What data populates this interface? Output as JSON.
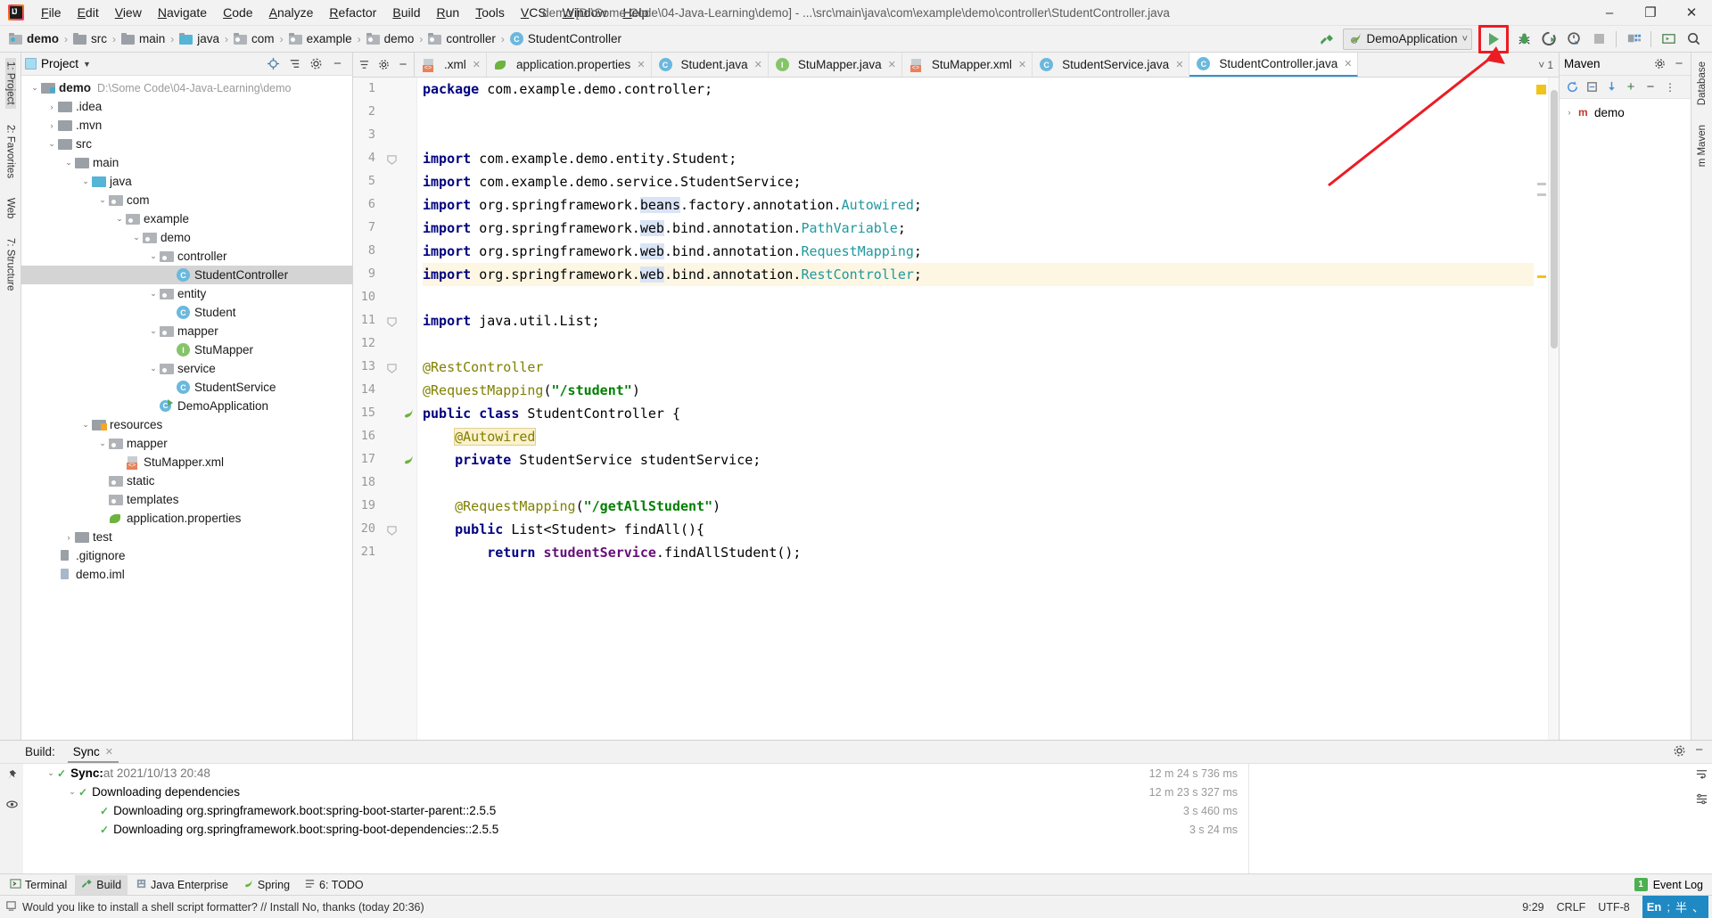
{
  "titlebar": {
    "window_title": "demo [D:\\Some Code\\04-Java-Learning\\demo] - ...\\src\\main\\java\\com\\example\\demo\\controller\\StudentController.java",
    "logo": "intellij-idea-logo",
    "menu": [
      "File",
      "Edit",
      "View",
      "Navigate",
      "Code",
      "Analyze",
      "Refactor",
      "Build",
      "Run",
      "Tools",
      "VCS",
      "Window",
      "Help"
    ],
    "window_controls": {
      "minimize": "–",
      "maximize": "❐",
      "close": "✕"
    }
  },
  "navbar": {
    "breadcrumbs": [
      {
        "label": "demo",
        "type": "module"
      },
      {
        "label": "src",
        "type": "folder"
      },
      {
        "label": "main",
        "type": "folder"
      },
      {
        "label": "java",
        "type": "source-root"
      },
      {
        "label": "com",
        "type": "package"
      },
      {
        "label": "example",
        "type": "package"
      },
      {
        "label": "demo",
        "type": "package"
      },
      {
        "label": "controller",
        "type": "package"
      },
      {
        "label": "StudentController",
        "type": "class"
      }
    ],
    "separator": "›",
    "toolbar": {
      "build_icon": "hammer-icon",
      "run_config_name": "DemoApplication",
      "run_config_dropdown": "˅",
      "run_icon": "run-play-icon",
      "debug_icon": "debug-bug-icon",
      "run_coverage_icon": "run-with-coverage-icon",
      "profiler_icon": "profiler-icon",
      "stop_icon": "stop-icon",
      "project_structure_icon": "project-structure-icon",
      "terminal_icon": "terminal-icon",
      "search_icon": "search-everywhere-icon"
    }
  },
  "annotation": {
    "type": "red-arrow-and-box",
    "color": "#ec1c24",
    "points_to": "run-button"
  },
  "left_rail": [
    {
      "label": "1: Project",
      "selected": true
    },
    {
      "label": "2: Favorites",
      "selected": false
    },
    {
      "label": "Web",
      "selected": false
    },
    {
      "label": "7: Structure",
      "selected": false
    }
  ],
  "right_rail": [
    {
      "label": "Database",
      "selected": false
    },
    {
      "label": "m Maven",
      "selected": false
    }
  ],
  "project_panel": {
    "title": "Project",
    "dropdown": "▼",
    "header_icons": [
      "locate-icon",
      "collapse-all-icon",
      "settings-gear-icon",
      "hide-icon"
    ],
    "tree": [
      {
        "indent": 0,
        "twist": "⌄",
        "icon": "module",
        "label": "demo",
        "bold": true,
        "path": "D:\\Some Code\\04-Java-Learning\\demo",
        "selected": false
      },
      {
        "indent": 1,
        "twist": "›",
        "icon": "folder",
        "label": ".idea",
        "selected": false
      },
      {
        "indent": 1,
        "twist": "›",
        "icon": "folder",
        "label": ".mvn",
        "selected": false
      },
      {
        "indent": 1,
        "twist": "⌄",
        "icon": "folder",
        "label": "src",
        "selected": false
      },
      {
        "indent": 2,
        "twist": "⌄",
        "icon": "folder",
        "label": "main",
        "selected": false
      },
      {
        "indent": 3,
        "twist": "⌄",
        "icon": "source-root",
        "label": "java",
        "selected": false
      },
      {
        "indent": 4,
        "twist": "⌄",
        "icon": "package",
        "label": "com",
        "selected": false
      },
      {
        "indent": 5,
        "twist": "⌄",
        "icon": "package",
        "label": "example",
        "selected": false
      },
      {
        "indent": 6,
        "twist": "⌄",
        "icon": "package",
        "label": "demo",
        "selected": false
      },
      {
        "indent": 7,
        "twist": "⌄",
        "icon": "package",
        "label": "controller",
        "selected": false
      },
      {
        "indent": 8,
        "twist": "",
        "icon": "class",
        "label": "StudentController",
        "selected": true
      },
      {
        "indent": 7,
        "twist": "⌄",
        "icon": "package",
        "label": "entity",
        "selected": false
      },
      {
        "indent": 8,
        "twist": "",
        "icon": "class",
        "label": "Student",
        "selected": false
      },
      {
        "indent": 7,
        "twist": "⌄",
        "icon": "package",
        "label": "mapper",
        "selected": false
      },
      {
        "indent": 8,
        "twist": "",
        "icon": "interface",
        "label": "StuMapper",
        "selected": false
      },
      {
        "indent": 7,
        "twist": "⌄",
        "icon": "package",
        "label": "service",
        "selected": false
      },
      {
        "indent": 8,
        "twist": "",
        "icon": "class",
        "label": "StudentService",
        "selected": false
      },
      {
        "indent": 7,
        "twist": "",
        "icon": "spring-app",
        "label": "DemoApplication",
        "selected": false
      },
      {
        "indent": 3,
        "twist": "⌄",
        "icon": "resources",
        "label": "resources",
        "selected": false
      },
      {
        "indent": 4,
        "twist": "⌄",
        "icon": "package",
        "label": "mapper",
        "selected": false
      },
      {
        "indent": 5,
        "twist": "",
        "icon": "xml-file",
        "label": "StuMapper.xml",
        "selected": false
      },
      {
        "indent": 4,
        "twist": "",
        "icon": "package",
        "label": "static",
        "selected": false
      },
      {
        "indent": 4,
        "twist": "",
        "icon": "package",
        "label": "templates",
        "selected": false
      },
      {
        "indent": 4,
        "twist": "",
        "icon": "spring-properties",
        "label": "application.properties",
        "selected": false
      },
      {
        "indent": 2,
        "twist": "›",
        "icon": "folder",
        "label": "test",
        "selected": false
      },
      {
        "indent": 1,
        "twist": "",
        "icon": "gitignore",
        "label": ".gitignore",
        "selected": false
      },
      {
        "indent": 1,
        "twist": "",
        "icon": "iml",
        "label": "demo.iml",
        "selected": false
      }
    ]
  },
  "editor": {
    "tab_strip_icons": [
      "sort-icon",
      "gear-icon",
      "hide-icon"
    ],
    "tabs": [
      {
        "label": ".xml",
        "icon": "xml-file",
        "active": false
      },
      {
        "label": "application.properties",
        "icon": "spring-properties",
        "active": false
      },
      {
        "label": "Student.java",
        "icon": "class",
        "active": false
      },
      {
        "label": "StuMapper.java",
        "icon": "interface",
        "active": false
      },
      {
        "label": "StuMapper.xml",
        "icon": "xml-file",
        "active": false
      },
      {
        "label": "StudentService.java",
        "icon": "class",
        "active": false
      },
      {
        "label": "StudentController.java",
        "icon": "class",
        "active": true
      }
    ],
    "tab_end": {
      "chevron": "˅",
      "count": "1"
    },
    "file_name": "StudentController.java",
    "lines": [
      {
        "n": 1,
        "tokens": [
          {
            "t": "package ",
            "c": "kw"
          },
          {
            "t": "com.example.demo.controller;",
            "c": "plain"
          }
        ]
      },
      {
        "n": 2,
        "tokens": []
      },
      {
        "n": 3,
        "tokens": []
      },
      {
        "n": 4,
        "tokens": [
          {
            "t": "import ",
            "c": "kw"
          },
          {
            "t": "com.example.demo.entity.",
            "c": "plain"
          },
          {
            "t": "Student",
            "c": "plain"
          },
          {
            "t": ";",
            "c": "plain"
          }
        ],
        "fold": true
      },
      {
        "n": 5,
        "tokens": [
          {
            "t": "import ",
            "c": "kw"
          },
          {
            "t": "com.example.demo.service.",
            "c": "plain"
          },
          {
            "t": "StudentService",
            "c": "plain"
          },
          {
            "t": ";",
            "c": "plain"
          }
        ]
      },
      {
        "n": 6,
        "tokens": [
          {
            "t": "import ",
            "c": "kw"
          },
          {
            "t": "org.springframework.",
            "c": "plain"
          },
          {
            "t": "beans",
            "c": "hl-blue"
          },
          {
            "t": ".factory.annotation.",
            "c": "plain"
          },
          {
            "t": "Autowired",
            "c": "cls-name"
          },
          {
            "t": ";",
            "c": "plain"
          }
        ]
      },
      {
        "n": 7,
        "tokens": [
          {
            "t": "import ",
            "c": "kw"
          },
          {
            "t": "org.springframework.",
            "c": "plain"
          },
          {
            "t": "web",
            "c": "hl-blue"
          },
          {
            "t": ".bind.annotation.",
            "c": "plain"
          },
          {
            "t": "PathVariable",
            "c": "cls-name"
          },
          {
            "t": ";",
            "c": "plain"
          }
        ]
      },
      {
        "n": 8,
        "tokens": [
          {
            "t": "import ",
            "c": "kw"
          },
          {
            "t": "org.springframework.",
            "c": "plain"
          },
          {
            "t": "web",
            "c": "hl-blue"
          },
          {
            "t": ".bind.annotation.",
            "c": "plain"
          },
          {
            "t": "RequestMapping",
            "c": "cls-name"
          },
          {
            "t": ";",
            "c": "plain"
          }
        ]
      },
      {
        "n": 9,
        "tokens": [
          {
            "t": "import ",
            "c": "kw"
          },
          {
            "t": "org.springframework.",
            "c": "plain"
          },
          {
            "t": "web",
            "c": "hl-blue"
          },
          {
            "t": ".bind.annotation.",
            "c": "plain"
          },
          {
            "t": "RestController",
            "c": "cls-name"
          },
          {
            "t": ";",
            "c": "plain"
          }
        ],
        "highlight": true
      },
      {
        "n": 10,
        "tokens": []
      },
      {
        "n": 11,
        "tokens": [
          {
            "t": "import ",
            "c": "kw"
          },
          {
            "t": "java.util.List;",
            "c": "plain"
          }
        ],
        "fold": true
      },
      {
        "n": 12,
        "tokens": []
      },
      {
        "n": 13,
        "tokens": [
          {
            "t": "@RestController",
            "c": "ann"
          }
        ],
        "fold": true
      },
      {
        "n": 14,
        "tokens": [
          {
            "t": "@RequestMapping",
            "c": "ann"
          },
          {
            "t": "(",
            "c": "plain"
          },
          {
            "t": "\"/student\"",
            "c": "str"
          },
          {
            "t": ")",
            "c": "plain"
          }
        ]
      },
      {
        "n": 15,
        "tokens": [
          {
            "t": "public ",
            "c": "kw"
          },
          {
            "t": "class ",
            "c": "kw"
          },
          {
            "t": "StudentController",
            "c": "plain"
          },
          {
            "t": " {",
            "c": "plain"
          }
        ],
        "gutter_icon": "spring-bean-icon"
      },
      {
        "n": 16,
        "tokens": [
          {
            "t": "    ",
            "c": "plain"
          },
          {
            "t": "@Autowired",
            "c": "ann hl-box"
          }
        ]
      },
      {
        "n": 17,
        "tokens": [
          {
            "t": "    ",
            "c": "plain"
          },
          {
            "t": "private ",
            "c": "kw"
          },
          {
            "t": "StudentService ",
            "c": "plain"
          },
          {
            "t": "studentService",
            "c": "plain"
          },
          {
            "t": ";",
            "c": "plain"
          }
        ],
        "gutter_icon": "spring-bean-icon"
      },
      {
        "n": 18,
        "tokens": []
      },
      {
        "n": 19,
        "tokens": [
          {
            "t": "    ",
            "c": "plain"
          },
          {
            "t": "@RequestMapping",
            "c": "ann"
          },
          {
            "t": "(",
            "c": "plain"
          },
          {
            "t": "\"/getAllStudent\"",
            "c": "str"
          },
          {
            "t": ")",
            "c": "plain"
          }
        ]
      },
      {
        "n": 20,
        "tokens": [
          {
            "t": "    ",
            "c": "plain"
          },
          {
            "t": "public ",
            "c": "kw"
          },
          {
            "t": "List<Student> ",
            "c": "plain"
          },
          {
            "t": "findAll",
            "c": "plain"
          },
          {
            "t": "(){",
            "c": "plain"
          }
        ],
        "fold": true
      },
      {
        "n": 21,
        "tokens": [
          {
            "t": "        ",
            "c": "plain"
          },
          {
            "t": "return ",
            "c": "kw"
          },
          {
            "t": "studentService",
            "c": "fld-ref"
          },
          {
            "t": ".",
            "c": "plain"
          },
          {
            "t": "findAllStudent",
            "c": "plain"
          },
          {
            "t": "();",
            "c": "plain"
          }
        ]
      }
    ]
  },
  "maven_panel": {
    "title": "Maven",
    "header_icons": [
      "settings-gear-icon",
      "hide-icon",
      "expand-icon"
    ],
    "toolbar_icons": [
      "reload-icon",
      "generate-sources-icon",
      "download-sources-icon",
      "add-icon",
      "collapse-icon",
      "more-icon"
    ],
    "tree": [
      {
        "twist": "›",
        "icon": "maven-project-icon",
        "label": "demo"
      }
    ]
  },
  "build_panel": {
    "title": "Build:",
    "tab": {
      "label": "Sync",
      "close": "✕"
    },
    "header_icons": [
      "settings-gear-icon",
      "hide-icon"
    ],
    "rail_icons": [
      "pin-icon",
      "eye-icon"
    ],
    "rows": [
      {
        "indent": 0,
        "twist": "⌄",
        "check": "✓",
        "bold_label": "Sync:",
        "label": " at 2021/10/13 20:48",
        "time": "12 m 24 s 736 ms"
      },
      {
        "indent": 1,
        "twist": "⌄",
        "check": "✓",
        "bold_label": "",
        "label": "Downloading dependencies",
        "time": "12 m 23 s 327 ms"
      },
      {
        "indent": 2,
        "twist": "",
        "check": "✓",
        "bold_label": "",
        "label": "Downloading org.springframework.boot:spring-boot-starter-parent::2.5.5",
        "time": "3 s 460 ms"
      },
      {
        "indent": 2,
        "twist": "",
        "check": "✓",
        "bold_label": "",
        "label": "Downloading org.springframework.boot:spring-boot-dependencies::2.5.5",
        "time": "3 s 24 ms"
      }
    ],
    "right_icons": [
      "wrap-text-icon",
      "settings-icon"
    ]
  },
  "toolwindow_bar": {
    "items": [
      {
        "label": "Terminal",
        "icon": "terminal-icon",
        "selected": false
      },
      {
        "label": "Build",
        "icon": "hammer-icon",
        "selected": true
      },
      {
        "label": "Java Enterprise",
        "icon": "java-ee-icon",
        "selected": false
      },
      {
        "label": "Spring",
        "icon": "spring-leaf-icon",
        "selected": false
      },
      {
        "label": "6: TODO",
        "icon": "todo-icon",
        "selected": false
      }
    ],
    "event_log": {
      "label": "Event Log",
      "badge": "1"
    }
  },
  "statusbar": {
    "message": "Would you like to install a shell script formatter? // Install   No, thanks (today 20:36)",
    "caret_position": "9:29",
    "line_separator": "CRLF",
    "encoding": "UTF-8",
    "ime": "En",
    "ime_icons": [
      "semicolon-icon",
      "half-width-icon",
      "punctuation-icon"
    ]
  }
}
